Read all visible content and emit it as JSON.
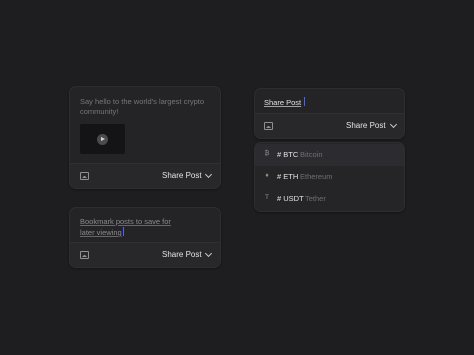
{
  "composer_media": {
    "placeholder": "Say hello to the world's largest crypto community!",
    "media_icon": "image-icon",
    "video_play_icon": "play-icon",
    "share_label": "Share Post"
  },
  "composer_bookmark": {
    "text_line1": "Bookmark posts to save for",
    "text_line2": "later viewing",
    "media_icon": "image-icon",
    "share_label": "Share Post"
  },
  "composer_share": {
    "input_value": "Share Post",
    "media_icon": "image-icon",
    "share_label": "Share Post"
  },
  "hashtag_dropdown": {
    "items": [
      {
        "icon": "₿",
        "icon_name": "bitcoin-icon",
        "symbol": "# BTC",
        "name": "Bitcoin"
      },
      {
        "icon": "♦",
        "icon_name": "ethereum-icon",
        "symbol": "# ETH",
        "name": "Ethereum"
      },
      {
        "icon": "T",
        "icon_name": "tether-icon",
        "symbol": "# USDT",
        "name": "Tether"
      }
    ]
  },
  "colors": {
    "background": "#1e1e20",
    "card": "#242427",
    "caret": "#4a62ff"
  }
}
